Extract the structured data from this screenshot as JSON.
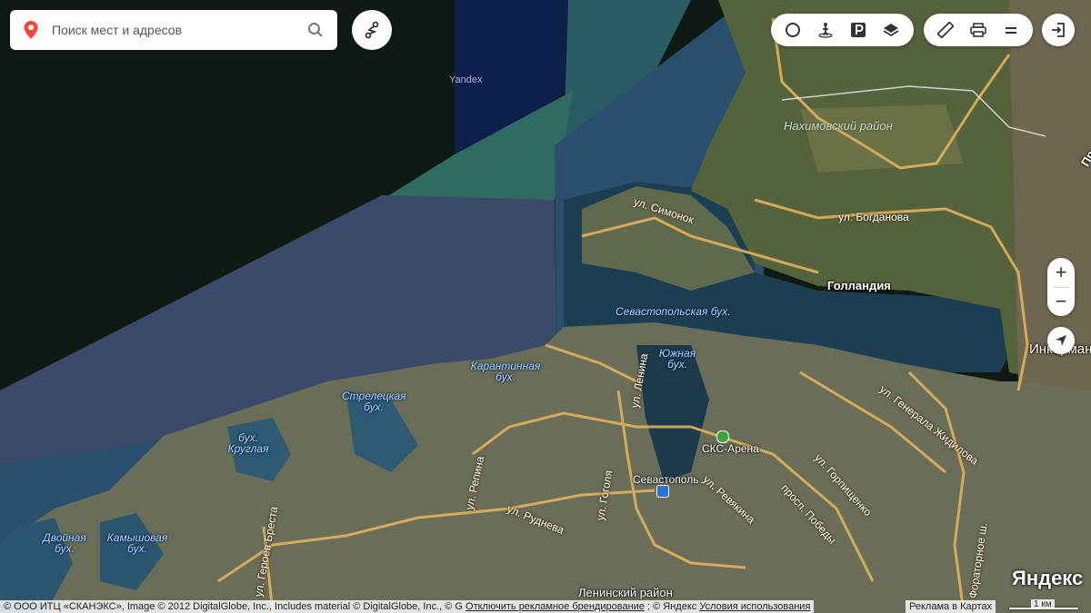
{
  "search": {
    "placeholder": "Поиск мест и адресов"
  },
  "watermark": "Yandex",
  "map_labels": {
    "nakhimovsky": "Нахимовский район",
    "simonok": "ул. Симонок",
    "bogdanova": "ул. Богданова",
    "gollandia": "Голландия",
    "sevastopolskaya": "Севастопольская бух.",
    "yuzhnaya": "Южная бух.",
    "karantinnaya": "Карантинная бух.",
    "streletskaya": "Стрелецкая бух.",
    "kruglaya": "бух. Круглая",
    "dvoynaya": "Двойная бух.",
    "kamyshovaya": "Камышовая бух.",
    "lenina": "ул. Ленина",
    "gogolya": "ул. Гоголя",
    "repina": "ул. Репина",
    "rudneva": "ул. Руднева",
    "revyakina": "ул. Ревякина",
    "pobedy": "просп. Победы",
    "gorpishchenko": "ул. Горпищенко",
    "zhidilova": "ул. Генерала Жидилова",
    "oratornoe": "Фораторное ш.",
    "breste": "ул. Героев Бреста",
    "sks": "СКС-Арена",
    "sevastopol": "Севастополь",
    "leninsky": "Ленинский район",
    "inkerman": "Инкерман",
    "pr": "Пр"
  },
  "zoom": {
    "in": "+",
    "out": "−"
  },
  "footer": {
    "copyright": "© ООО ИТЦ «СКАНЭКС», Image © 2012 DigitalGlobe, Inc., Includes material © DigitalGlobe, Inc., © G",
    "disable_ads": "Отключить рекламное брендирование",
    "yandex": "; © Яндекс",
    "terms": "Условия использования",
    "ads": "Реклама в Картах",
    "scale": "1 км",
    "logo": "Яндекс"
  },
  "colors": {
    "road": "#e0b25c",
    "water": "#1d3d4f",
    "land": "#4c5a34",
    "sea_dark": "#0f1a12"
  }
}
